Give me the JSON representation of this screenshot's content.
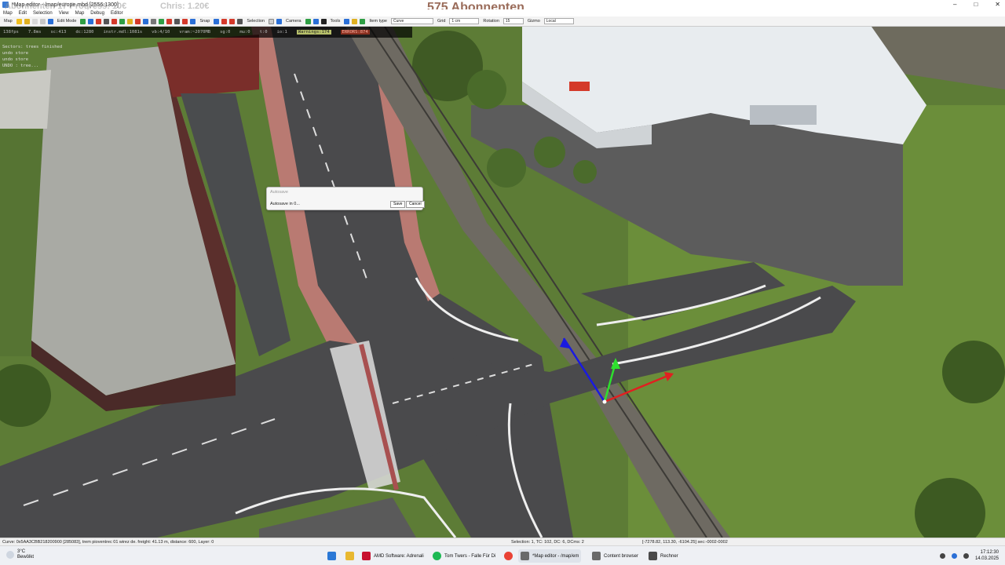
{
  "window": {
    "title": "*Map editor - /map/europe.mbd [2556:1300]",
    "controls": [
      "–",
      "□",
      "✕"
    ]
  },
  "overlay": {
    "subscribers": "575 Abonnenten",
    "ghost_left": "Abonnenten 17  Progress: 10€",
    "ghost_right": "Chris: 1.20€"
  },
  "menu": [
    "Map",
    "Edit",
    "Selection",
    "View",
    "Map",
    "Debug",
    "Editor"
  ],
  "toolbar": {
    "map_label": "Map",
    "edit_mode_label": "Edit Mode",
    "snap_label": "Snap",
    "selection_label": "Selection",
    "camera_label": "Camera",
    "tools_label": "Tools",
    "item_type_label": "Item type",
    "item_type_value": "Curve",
    "grid_label": "Grid",
    "grid_value": "1 cm",
    "rotation_label": "Rotation",
    "rotation_value": "15",
    "gizmo_label": "Gizmo",
    "gizmo_value": "Local",
    "colors": {
      "accent": "#2a6fd6",
      "red": "#d43a2a",
      "green": "#2f9e44",
      "yellow": "#e0b020"
    }
  },
  "stats": {
    "fps": "138fps",
    "ms": "7.8ms",
    "sc": "sc:413",
    "dc": "dc:1280",
    "instr": "instr.mdl:1081s",
    "vb": "vb:4/10",
    "vram": "vram:~2070MB",
    "sg": "sg:0",
    "mu": "mu:0",
    "tr": "t:0",
    "io": "io:1",
    "warnings": "Warnings:174",
    "errors": "ERRORS:874"
  },
  "console": [
    "Sectors: trees finished",
    "undo store",
    "undo store",
    "UNDO : tree..."
  ],
  "dialog": {
    "title": "Autosave",
    "message": "Autosave in 0...",
    "save_label": "Save",
    "cancel_label": "Cancel"
  },
  "status": {
    "left": "Curve: 0x5AA3CBB218200900 [285083], trem pioventrec 01 wirez de. freight: 41.13 m, distance: 600, Layer: 0",
    "mid": "Selection: 1, TC: 102, DC: 6, DCms: 2",
    "right": "[-7278.82, 113.30, -6104.25] sec:-0002-0002"
  },
  "taskbar": {
    "temp": "3°C",
    "weather": "Bewölkt",
    "tasks": [
      {
        "label": "AMD Software: Adrenali",
        "color": "#c8102e"
      },
      {
        "label": "Tom Twers - Falle Für Di",
        "color": "#1db954"
      },
      {
        "label": "*Map editor - /map/em",
        "color": "#6a6a6a"
      },
      {
        "label": "Content browser",
        "color": "#6a6a6a"
      },
      {
        "label": "Rechner",
        "color": "#4a4a4a"
      }
    ],
    "time": "17:12:30",
    "date": "14.03.2025"
  }
}
